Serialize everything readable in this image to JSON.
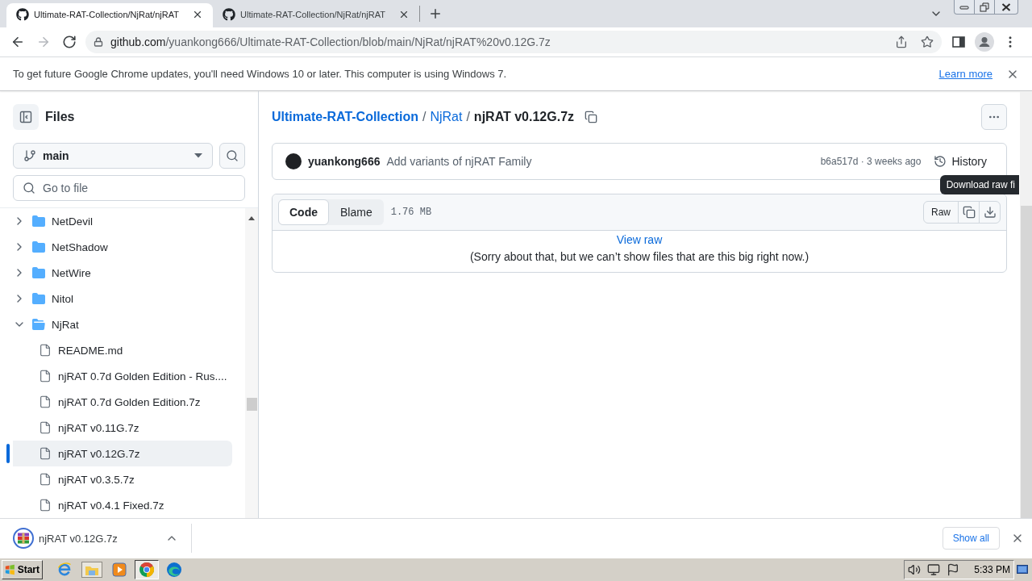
{
  "browser": {
    "tabs": [
      {
        "title": "Ultimate-RAT-Collection/NjRat/njRAT",
        "selected": true
      },
      {
        "title": "Ultimate-RAT-Collection/NjRat/njRAT",
        "selected": false
      }
    ],
    "nav_buttons": [
      {
        "kind": "back",
        "disabled": false
      },
      {
        "kind": "forward",
        "disabled": true
      },
      {
        "kind": "reload",
        "disabled": false
      }
    ],
    "address": {
      "host": "github.com",
      "path": "/yuankong666/Ultimate-RAT-Collection/blob/main/NjRat/njRAT%20v0.12G.7z"
    },
    "infobar": {
      "message": "To get future Google Chrome updates, you'll need Windows 10 or later. This computer is using Windows 7.",
      "link": "Learn more"
    }
  },
  "sidebar": {
    "title": "Files",
    "branch": "main",
    "search": {
      "placeholder": "Go to file"
    },
    "tree": [
      {
        "name": "NetDevil",
        "kind": "folder",
        "expanded": false,
        "selected": false
      },
      {
        "name": "NetShadow",
        "kind": "folder",
        "expanded": false,
        "selected": false
      },
      {
        "name": "NetWire",
        "kind": "folder",
        "expanded": false,
        "selected": false
      },
      {
        "name": "Nitol",
        "kind": "folder",
        "expanded": false,
        "selected": false
      },
      {
        "name": "NjRat",
        "kind": "folder",
        "expanded": true,
        "selected": false,
        "children": [
          {
            "name": "README.md",
            "kind": "file",
            "selected": false
          },
          {
            "name": "njRAT 0.7d Golden Edition - Rus....",
            "kind": "file",
            "selected": false
          },
          {
            "name": "njRAT 0.7d Golden Edition.7z",
            "kind": "file",
            "selected": false
          },
          {
            "name": "njRAT v0.11G.7z",
            "kind": "file",
            "selected": false
          },
          {
            "name": "njRAT v0.12G.7z",
            "kind": "file",
            "selected": true
          },
          {
            "name": "njRAT v0.3.5.7z",
            "kind": "file",
            "selected": false
          },
          {
            "name": "njRAT v0.4.1 Fixed.7z",
            "kind": "file",
            "selected": false
          }
        ]
      }
    ]
  },
  "breadcrumb": [
    {
      "kind": "repo",
      "text": "Ultimate-RAT-Collection"
    },
    {
      "kind": "separator",
      "text": "/"
    },
    {
      "kind": "link",
      "text": "NjRat"
    },
    {
      "kind": "separator",
      "text": "/"
    },
    {
      "kind": "current",
      "text": "njRAT v0.12G.7z"
    }
  ],
  "commit": {
    "author": "yuankong666",
    "message": "Add variants of njRAT Family",
    "meta": "b6a517d · 3 weeks ago",
    "history": "History"
  },
  "file": {
    "views": [
      {
        "label": "Code",
        "selected": true
      },
      {
        "label": "Blame",
        "selected": false
      }
    ],
    "size": "1.76 MB",
    "raw": "Raw",
    "tooltip": "Download raw fi",
    "view_raw": "View raw",
    "notice": "(Sorry about that, but we can’t show files that are this big right now.)"
  },
  "downloads": {
    "items": [
      {
        "name": "njRAT v0.12G.7z"
      }
    ],
    "show_all": "Show all"
  },
  "taskbar": {
    "start": "Start",
    "apps": [
      {
        "kind": "internet",
        "active": false
      },
      {
        "kind": "files",
        "active": false
      },
      {
        "kind": "media",
        "active": false
      },
      {
        "kind": "browser",
        "active": true
      },
      {
        "kind": "edge",
        "active": false
      }
    ],
    "clock": "5:33 PM"
  }
}
